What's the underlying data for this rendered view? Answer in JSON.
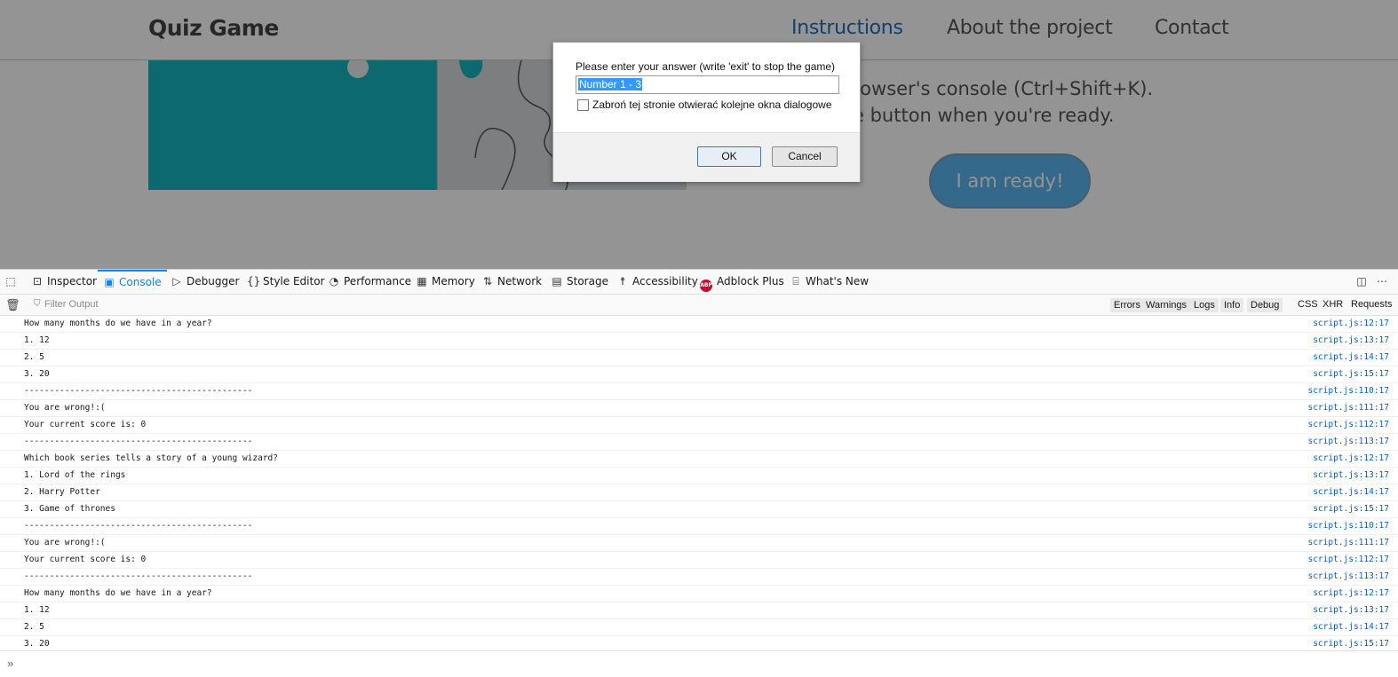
{
  "page": {
    "brand": "Quiz Game",
    "nav": [
      "Instructions",
      "About the project",
      "Contact"
    ],
    "hero_text_line1": "rowser's console (Ctrl+Shift+K).",
    "hero_text_line2": "e button when you're ready.",
    "ready_button": "I am ready!"
  },
  "dialog": {
    "message": "Please enter your answer (write 'exit' to stop the game)",
    "input_value": "Number 1 - 3",
    "checkbox_label": "Zabroń tej stronie otwierać kolejne okna dialogowe",
    "ok_label": "OK",
    "cancel_label": "Cancel"
  },
  "devtools": {
    "tabs": [
      "Inspector",
      "Console",
      "Debugger",
      "Style Editor",
      "Performance",
      "Memory",
      "Network",
      "Storage",
      "Accessibility",
      "Adblock Plus",
      "What's New"
    ],
    "active_tab": "Console",
    "adblock_badge": "ABP",
    "filter_placeholder": "Filter Output",
    "filter_buttons": [
      "Errors",
      "Warnings",
      "Logs",
      "Info",
      "Debug"
    ],
    "filter_text": [
      "CSS",
      "XHR",
      "Requests"
    ],
    "logs": [
      {
        "msg": "How many months do we have in a year?",
        "src": "script.js:12:17"
      },
      {
        "msg": "1. 12",
        "src": "script.js:13:17"
      },
      {
        "msg": "2. 5",
        "src": "script.js:14:17"
      },
      {
        "msg": "3. 20",
        "src": "script.js:15:17"
      },
      {
        "msg": "---------------------------------------------",
        "src": "script.js:110:17"
      },
      {
        "msg": "You are wrong!:(",
        "src": "script.js:111:17"
      },
      {
        "msg": "Your current score is: 0",
        "src": "script.js:112:17"
      },
      {
        "msg": "---------------------------------------------",
        "src": "script.js:113:17"
      },
      {
        "msg": "Which book series tells a story of a young wizard?",
        "src": "script.js:12:17"
      },
      {
        "msg": "1. Lord of the rings",
        "src": "script.js:13:17"
      },
      {
        "msg": "2. Harry Potter",
        "src": "script.js:14:17"
      },
      {
        "msg": "3. Game of thrones",
        "src": "script.js:15:17"
      },
      {
        "msg": "---------------------------------------------",
        "src": "script.js:110:17"
      },
      {
        "msg": "You are wrong!:(",
        "src": "script.js:111:17"
      },
      {
        "msg": "Your current score is: 0",
        "src": "script.js:112:17"
      },
      {
        "msg": "---------------------------------------------",
        "src": "script.js:113:17"
      },
      {
        "msg": "How many months do we have in a year?",
        "src": "script.js:12:17"
      },
      {
        "msg": "1. 12",
        "src": "script.js:13:17"
      },
      {
        "msg": "2. 5",
        "src": "script.js:14:17"
      },
      {
        "msg": "3. 20",
        "src": "script.js:15:17"
      }
    ]
  },
  "colors": {
    "accent": "#0a84ff",
    "nav_active": "#1f6fc0",
    "ready_button": "#5bb6ef",
    "hero_teal": "#15b5c2"
  },
  "icons": {
    "inspector": "pick-element-icon",
    "console": "console-icon",
    "debugger": "debugger-icon",
    "style_editor": "braces-icon",
    "performance": "gauge-icon",
    "memory": "chip-icon",
    "network": "arrows-icon",
    "storage": "storage-icon",
    "accessibility": "accessibility-icon",
    "whats_new": "gift-icon"
  }
}
